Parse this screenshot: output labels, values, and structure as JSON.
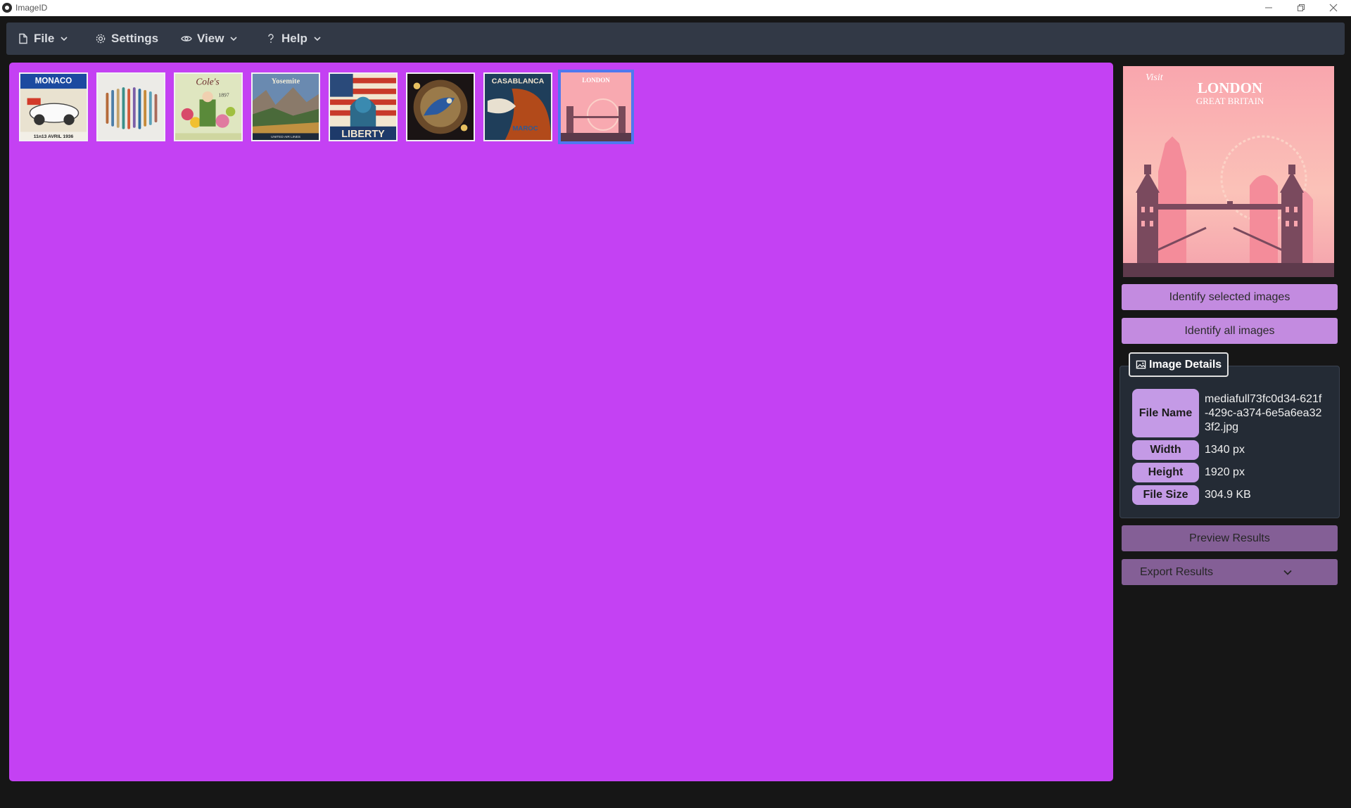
{
  "window": {
    "title": "ImageID"
  },
  "menu": {
    "file": "File",
    "settings": "Settings",
    "view": "View",
    "help": "Help"
  },
  "gallery": {
    "thumbnails": [
      {
        "name": "thumb-monaco",
        "caption": "MONACO",
        "caption2": "11n13 AVRIL 1936"
      },
      {
        "name": "thumb-feathers",
        "caption": ""
      },
      {
        "name": "thumb-coles",
        "caption": "Cole's",
        "caption2": "1897"
      },
      {
        "name": "thumb-yosemite",
        "caption": "Yosemite",
        "caption2": "UNITED AIR LINES"
      },
      {
        "name": "thumb-liberty",
        "caption": "LIBERTY"
      },
      {
        "name": "thumb-bird",
        "caption": ""
      },
      {
        "name": "thumb-casablanca",
        "caption": "CASABLANCA",
        "caption2": "MAROC"
      },
      {
        "name": "thumb-london",
        "caption": "LONDON",
        "selected": true
      }
    ]
  },
  "preview": {
    "visit": "Visit",
    "city": "LONDON",
    "country": "GREAT BRITAIN"
  },
  "actions": {
    "identify_selected": "Identify selected images",
    "identify_all": "Identify all images",
    "preview_results": "Preview Results",
    "export_results": "Export Results"
  },
  "details": {
    "tab_label": "Image Details",
    "file_name_label": "File Name",
    "file_name": "mediafull73fc0d34-621f-429c-a374-6e5a6ea323f2.jpg",
    "width_label": "Width",
    "width": "1340 px",
    "height_label": "Height",
    "height": "1920 px",
    "file_size_label": "File Size",
    "file_size": "304.9 KB"
  },
  "colors": {
    "gallery_bg": "#c441f3",
    "menubar_bg": "#323946",
    "button_bg": "#c38be0",
    "button_muted_bg": "#845f96",
    "selected_border": "#4f78f0"
  }
}
